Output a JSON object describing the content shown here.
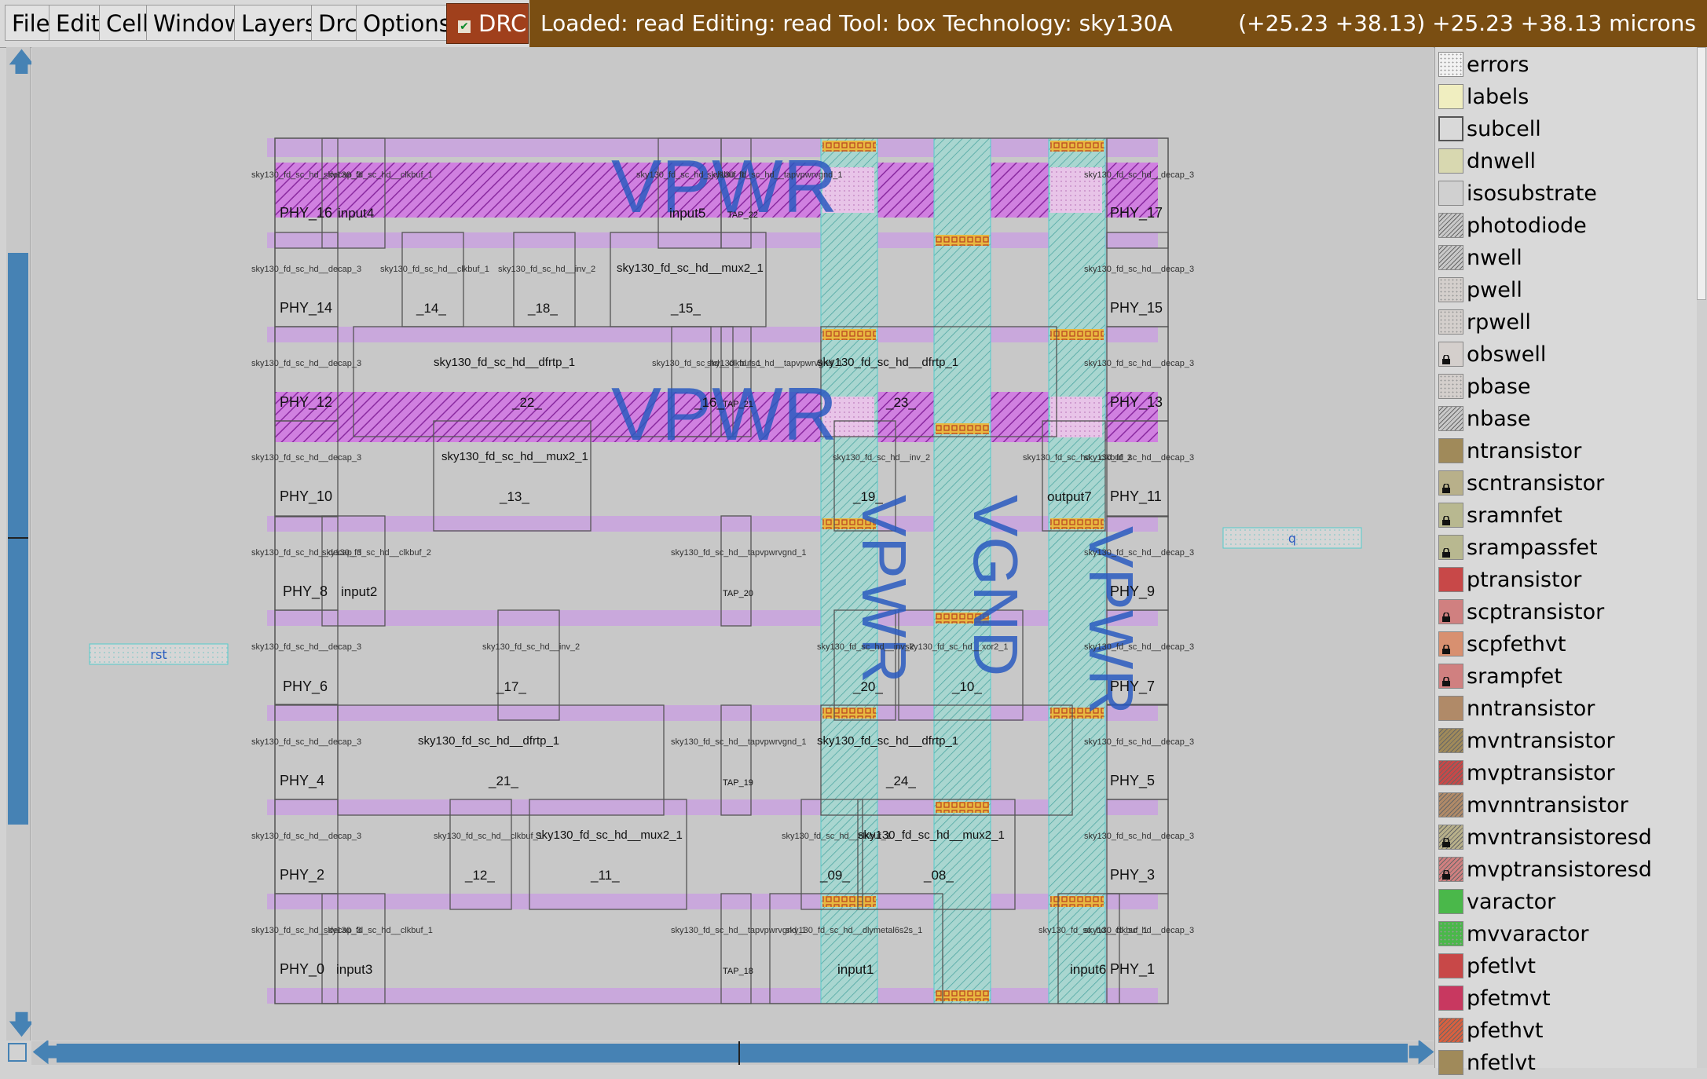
{
  "menu": [
    "File",
    "Edit",
    "Cell",
    "Window",
    "Layers",
    "Drc",
    "Options"
  ],
  "drc_label": "DRC",
  "status": {
    "left": "Loaded: read Editing: read Tool: box  Technology: sky130A",
    "right": "(+25.23 +38.13) +25.23 +38.13 microns"
  },
  "layout": {
    "big_labels": {
      "vpwr": "VPWR",
      "vgnd": "VGND"
    },
    "ports": {
      "rst": "rst",
      "q": "q"
    },
    "rows": [
      {
        "left_cell": "sky130_fd_sc_hd__decap_3",
        "left": "PHY_16",
        "right_cell": "sky130_fd_sc_hd__decap_3",
        "right": "PHY_17"
      },
      {
        "left_cell": "sky130_fd_sc_hd__decap_3",
        "left": "PHY_14",
        "right_cell": "sky130_fd_sc_hd__decap_3",
        "right": "PHY_15"
      },
      {
        "left_cell": "sky130_fd_sc_hd__decap_3",
        "left": "PHY_12",
        "right_cell": "sky130_fd_sc_hd__decap_3",
        "right": "PHY_13"
      },
      {
        "left_cell": "sky130_fd_sc_hd__decap_3",
        "left": "PHY_10",
        "right_cell": "sky130_fd_sc_hd__decap_3",
        "right": "PHY_11"
      },
      {
        "left_cell": "sky130_fd_sc_hd__decap_3",
        "left": "PHY_8",
        "right_cell": "sky130_fd_sc_hd__decap_3",
        "right": "PHY_9"
      },
      {
        "left_cell": "sky130_fd_sc_hd__decap_3",
        "left": "PHY_6",
        "right_cell": "sky130_fd_sc_hd__decap_3",
        "right": "PHY_7"
      },
      {
        "left_cell": "sky130_fd_sc_hd__decap_3",
        "left": "PHY_4",
        "right_cell": "sky130_fd_sc_hd__decap_3",
        "right": "PHY_5"
      },
      {
        "left_cell": "sky130_fd_sc_hd__decap_3",
        "left": "PHY_2",
        "right_cell": "sky130_fd_sc_hd__decap_3",
        "right": "PHY_3"
      },
      {
        "left_cell": "sky130_fd_sc_hd__decap_3",
        "left": "PHY_0",
        "right_cell": "sky130_fd_sc_hd__decap_3",
        "right": "PHY_1"
      }
    ],
    "cells": [
      {
        "type": "sky130_fd_sc_hd__clkbuf_1",
        "name": "input4"
      },
      {
        "type": "sky130_fd_sc_hd__clkbuf_1",
        "name": "input5"
      },
      {
        "type": "sky130_fd_sc_hd__tapvpwrvgnd_1",
        "name": "TAP_22"
      },
      {
        "type": "sky130_fd_sc_hd__clkbuf_1",
        "name": "_14_"
      },
      {
        "type": "sky130_fd_sc_hd__inv_2",
        "name": "_18_"
      },
      {
        "type": "sky130_fd_sc_hd__mux2_1",
        "name": "_15_"
      },
      {
        "type": "sky130_fd_sc_hd__dfrtp_1",
        "name": "_22_"
      },
      {
        "type": "sky130_fd_sc_hd__clkbuf_1",
        "name": "_16_"
      },
      {
        "type": "sky130_fd_sc_hd__tapvpwrvgnd_1",
        "name": "TAP_21"
      },
      {
        "type": "sky130_fd_sc_hd__dfrtp_1",
        "name": "_23_"
      },
      {
        "type": "sky130_fd_sc_hd__mux2_1",
        "name": "_13_"
      },
      {
        "type": "sky130_fd_sc_hd__inv_2",
        "name": "_19_"
      },
      {
        "type": "sky130_fd_sc_hd__clkbuf_2",
        "name": "output7"
      },
      {
        "type": "sky130_fd_sc_hd__clkbuf_2",
        "name": "input2"
      },
      {
        "type": "sky130_fd_sc_hd__tapvpwrvgnd_1",
        "name": "TAP_20"
      },
      {
        "type": "sky130_fd_sc_hd__inv_2",
        "name": "_17_"
      },
      {
        "type": "sky130_fd_sc_hd__inv_2",
        "name": "_20_"
      },
      {
        "type": "sky130_fd_sc_hd__xor2_1",
        "name": "_10_"
      },
      {
        "type": "sky130_fd_sc_hd__dfrtp_1",
        "name": "_21_"
      },
      {
        "type": "sky130_fd_sc_hd__tapvpwrvgnd_1",
        "name": "TAP_19"
      },
      {
        "type": "sky130_fd_sc_hd__dfrtp_1",
        "name": "_24_"
      },
      {
        "type": "sky130_fd_sc_hd__clkbuf_1",
        "name": "_12_"
      },
      {
        "type": "sky130_fd_sc_hd__mux2_1",
        "name": "_11_"
      },
      {
        "type": "sky130_fd_sc_hd__clkbuf_1",
        "name": "_09_"
      },
      {
        "type": "sky130_fd_sc_hd__mux2_1",
        "name": "_08_"
      },
      {
        "type": "sky130_fd_sc_hd__clkbuf_1",
        "name": "input3"
      },
      {
        "type": "sky130_fd_sc_hd__tapvpwrvgnd_1",
        "name": "TAP_18"
      },
      {
        "type": "sky130_fd_sc_hd__dlymetal6s2s_1",
        "name": "input1"
      },
      {
        "type": "sky130_fd_sc_hd__clkbuf_1",
        "name": "input6"
      }
    ]
  },
  "layers": [
    {
      "name": "errors",
      "color": "#f2f2f2",
      "pattern": "dots",
      "lock": false
    },
    {
      "name": "labels",
      "color": "#f0eec0",
      "pattern": "solid",
      "lock": false
    },
    {
      "name": "subcell",
      "color": "#d9d9d9",
      "pattern": "outline",
      "lock": false
    },
    {
      "name": "dnwell",
      "color": "#d8d8b0",
      "pattern": "solid",
      "lock": false
    },
    {
      "name": "isosubstrate",
      "color": "#d0d0d0",
      "pattern": "solid",
      "lock": false
    },
    {
      "name": "photodiode",
      "color": "#c8c8c8",
      "pattern": "hatch",
      "lock": false
    },
    {
      "name": "nwell",
      "color": "#c8c8c8",
      "pattern": "hatch",
      "lock": false
    },
    {
      "name": "pwell",
      "color": "#d4cfcc",
      "pattern": "dots",
      "lock": false
    },
    {
      "name": "rpwell",
      "color": "#d4cfcc",
      "pattern": "dots",
      "lock": false
    },
    {
      "name": "obswell",
      "color": "#d4cfcc",
      "pattern": "solid",
      "lock": true
    },
    {
      "name": "pbase",
      "color": "#d4cfcc",
      "pattern": "dots",
      "lock": false
    },
    {
      "name": "nbase",
      "color": "#c8c8c8",
      "pattern": "hatch",
      "lock": false
    },
    {
      "name": "ntransistor",
      "color": "#a08a5a",
      "pattern": "solid",
      "lock": false
    },
    {
      "name": "scntransistor",
      "color": "#b8b08a",
      "pattern": "solid",
      "lock": true
    },
    {
      "name": "sramnfet",
      "color": "#b8b890",
      "pattern": "solid",
      "lock": true
    },
    {
      "name": "srampassfet",
      "color": "#b8b890",
      "pattern": "solid",
      "lock": true
    },
    {
      "name": "ptransistor",
      "color": "#c84848",
      "pattern": "solid",
      "lock": false
    },
    {
      "name": "scptransistor",
      "color": "#d08080",
      "pattern": "solid",
      "lock": true
    },
    {
      "name": "scpfethvt",
      "color": "#d89070",
      "pattern": "solid",
      "lock": true
    },
    {
      "name": "srampfet",
      "color": "#d08080",
      "pattern": "solid",
      "lock": true
    },
    {
      "name": "nntransistor",
      "color": "#b08a68",
      "pattern": "solid",
      "lock": false
    },
    {
      "name": "mvntransistor",
      "color": "#a08a5a",
      "pattern": "hatch",
      "lock": false
    },
    {
      "name": "mvptransistor",
      "color": "#c84848",
      "pattern": "hatch",
      "lock": false
    },
    {
      "name": "mvnntransistor",
      "color": "#b08a68",
      "pattern": "hatch",
      "lock": false
    },
    {
      "name": "mvntransistoresd",
      "color": "#b8b08a",
      "pattern": "hatch",
      "lock": true
    },
    {
      "name": "mvptransistoresd",
      "color": "#d08080",
      "pattern": "hatch",
      "lock": true
    },
    {
      "name": "varactor",
      "color": "#4ab84a",
      "pattern": "solid",
      "lock": false
    },
    {
      "name": "mvvaractor",
      "color": "#4ab84a",
      "pattern": "dots",
      "lock": false
    },
    {
      "name": "pfetlvt",
      "color": "#c84848",
      "pattern": "solid",
      "lock": false
    },
    {
      "name": "pfetmvt",
      "color": "#c83860",
      "pattern": "solid",
      "lock": false
    },
    {
      "name": "pfethvt",
      "color": "#d86040",
      "pattern": "hatch",
      "lock": false
    },
    {
      "name": "nfetlvt",
      "color": "#a08a5a",
      "pattern": "solid",
      "lock": false
    }
  ]
}
